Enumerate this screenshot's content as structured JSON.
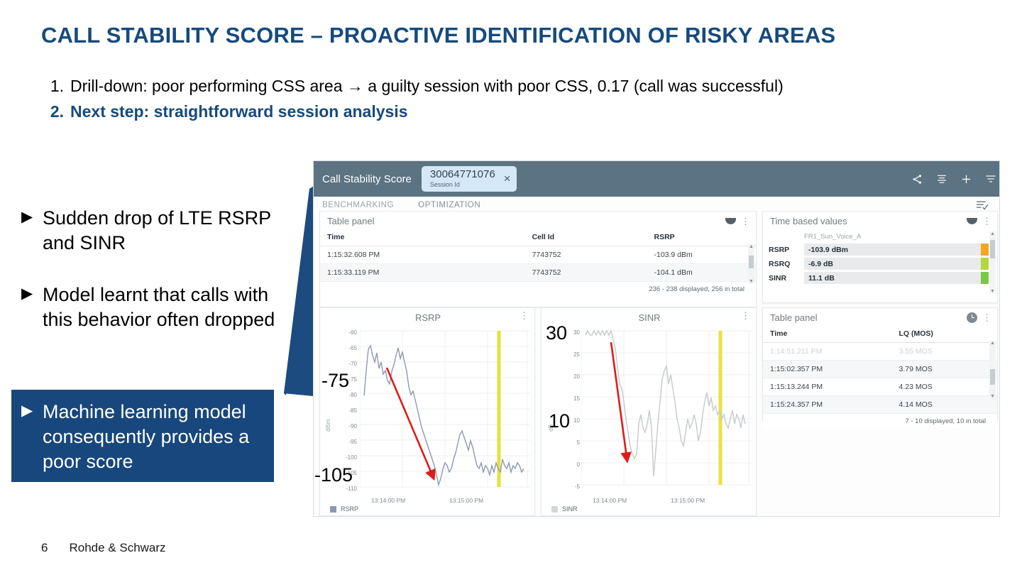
{
  "slide": {
    "title": "CALL STABILITY SCORE – PROACTIVE IDENTIFICATION OF RISKY AREAS",
    "title_color": "#174a7c",
    "numbered_list": [
      {
        "num": "1.",
        "text": "Drill-down: poor performing CSS area → a guilty session with poor CSS, 0.17 (call was successful)"
      },
      {
        "num": "2.",
        "text": "Next step: straightforward session analysis"
      }
    ],
    "bullets": [
      {
        "marker": "▶",
        "text": "Sudden drop of LTE RSRP and SINR"
      },
      {
        "marker": "▶",
        "text": "Model learnt that calls with this behavior often dropped"
      }
    ],
    "highlight_box": {
      "marker": "▶",
      "text": "Machine learning model consequently provides a poor score",
      "bg_color": "#17477c",
      "text_color": "#ffffff"
    },
    "footer": {
      "page_number": "6",
      "company": "Rohde & Schwarz"
    },
    "pointer_color": "#1c4b80"
  },
  "app": {
    "header": {
      "title": "Call Stability Score",
      "bg_color": "#5b7382",
      "session_chip": {
        "value": "30064771076",
        "label": "Session Id",
        "close": "×",
        "bg_color": "#d4e8f7"
      },
      "icons": [
        "share-icon",
        "align-center-icon",
        "plus-icon",
        "filter-icon"
      ]
    },
    "tabs": [
      {
        "label": "BENCHMARKING",
        "active": false
      },
      {
        "label": "OPTIMIZATION",
        "active": true
      }
    ],
    "tab_accent_color": "#c0392b",
    "list_check_icon": "list-check-icon",
    "panels": {
      "top_table": {
        "title": "Table panel",
        "columns": [
          "Time",
          "Cell Id",
          "RSRP"
        ],
        "rows": [
          [
            "1:15:32.608 PM",
            "7743752",
            "-103.9 dBm"
          ],
          [
            "1:15:33.119 PM",
            "7743752",
            "-104.1 dBm"
          ]
        ],
        "footer": "236 - 238 displayed, 256 in total"
      },
      "time_based_values": {
        "title": "Time based values",
        "column_header": "FR1_Sun_Voice_A",
        "rows": [
          {
            "label": "RSRP",
            "value": "-103.9 dBm",
            "color": "#f5a623"
          },
          {
            "label": "RSRQ",
            "value": "-6.9 dB",
            "color": "#b4d83a"
          },
          {
            "label": "SINR",
            "value": "11.1 dB",
            "color": "#7ac943"
          }
        ]
      },
      "bottom_table": {
        "title": "Table panel",
        "icon": "clock-icon",
        "columns": [
          "Time",
          "LQ (MOS)"
        ],
        "rows": [
          [
            "1:14:51.211 PM",
            "3.55 MOS"
          ],
          [
            "1:15:02.357 PM",
            "3.79 MOS"
          ],
          [
            "1:15:13.244 PM",
            "4.23 MOS"
          ],
          [
            "1:15:24.357 PM",
            "4.14 MOS"
          ]
        ],
        "footer": "7 - 10 displayed, 10 in total"
      }
    }
  },
  "chart_data": [
    {
      "type": "line",
      "title": "RSRP",
      "ylabel": "dBm",
      "xlabel": "",
      "ylim": [
        -110,
        -60
      ],
      "yticks": [
        -60,
        -65,
        -70,
        -75,
        -80,
        -85,
        -90,
        -95,
        -100,
        -105,
        -110
      ],
      "xticks": [
        "13:14:00 PM",
        "13:15:00 PM"
      ],
      "grid": true,
      "legend": [
        "RSRP"
      ],
      "legend_position": "bottom-left",
      "series_color": "#8d99ae",
      "marker_line": {
        "color": "#e8e23c",
        "label": ""
      },
      "annotation_arrow": {
        "color": "#e01b1b",
        "from": [
          -72,
          "13:13:50"
        ],
        "to": [
          -109,
          "13:14:08"
        ]
      },
      "overlay_labels": [
        "-75",
        "-105"
      ],
      "values": [
        -81,
        -73,
        -66,
        -65,
        -68,
        -70,
        -67,
        -72,
        -70,
        -74,
        -73,
        -76,
        -77,
        -73,
        -71,
        -68,
        -66,
        -69,
        -67,
        -70,
        -73,
        -78,
        -80,
        -79,
        -82,
        -85,
        -88,
        -91,
        -93,
        -95,
        -97,
        -99,
        -101,
        -103,
        -106,
        -109,
        -107,
        -104,
        -102,
        -103,
        -105,
        -104,
        -101,
        -99,
        -96,
        -93,
        -92,
        -94,
        -96,
        -98,
        -95,
        -97,
        -100,
        -103,
        -104,
        -102,
        -105,
        -103,
        -104,
        -106,
        -103,
        -105,
        -102,
        -104,
        -105,
        -101,
        -103,
        -104,
        -102,
        -105,
        -103,
        -104,
        -102,
        -103,
        -105,
        -104
      ]
    },
    {
      "type": "line",
      "title": "SINR",
      "ylabel": "dB",
      "xlabel": "",
      "ylim": [
        -5,
        30
      ],
      "yticks": [
        30,
        25,
        20,
        15,
        10,
        5,
        0,
        -5
      ],
      "xticks": [
        "13:14:00 PM",
        "13:15:00 PM"
      ],
      "grid": true,
      "legend": [
        "SINR"
      ],
      "legend_position": "bottom-left",
      "series_color": "#c9cccf",
      "marker_line": {
        "color": "#e8e23c",
        "label": ""
      },
      "annotation_arrow": {
        "color": "#e01b1b",
        "from": [
          28,
          "13:13:52"
        ],
        "to": [
          1.5,
          "13:14:07"
        ]
      },
      "overlay_labels": [
        "30",
        "10"
      ],
      "values": [
        29,
        30,
        29,
        29,
        30,
        29,
        30,
        29,
        30,
        29,
        30,
        29,
        30,
        28,
        26,
        22,
        18,
        17,
        14,
        10,
        7,
        4,
        2,
        1,
        2,
        9,
        11,
        8,
        7,
        9,
        12,
        8,
        -2,
        4,
        9,
        14,
        19,
        21,
        22,
        18,
        20,
        17,
        14,
        10,
        8,
        5,
        4,
        7,
        10,
        8,
        9,
        11,
        9,
        6,
        8,
        12,
        15,
        17,
        14,
        16,
        13,
        14,
        12,
        13,
        11,
        12,
        10,
        9,
        11,
        13,
        10,
        12,
        11,
        9,
        12,
        10
      ]
    }
  ]
}
